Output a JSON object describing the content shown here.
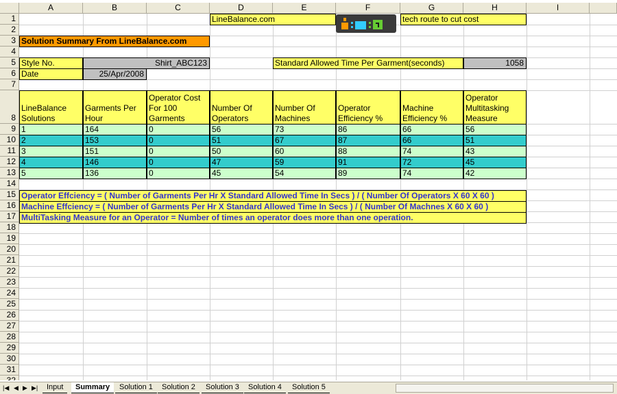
{
  "columns": [
    "A",
    "B",
    "C",
    "D",
    "E",
    "F",
    "G",
    "H",
    "I"
  ],
  "rows": [
    "1",
    "2",
    "3",
    "4",
    "5",
    "6",
    "7",
    "8",
    "9",
    "10",
    "11",
    "12",
    "13",
    "14",
    "15",
    "16",
    "17",
    "18",
    "19",
    "20",
    "21",
    "22",
    "23",
    "24",
    "25",
    "26",
    "27",
    "28",
    "29",
    "30",
    "31",
    "32"
  ],
  "header_cells": {
    "linebalance": "LineBalance.com",
    "tech_route": "tech route to cut cost",
    "summary_title": "Solution Summary From LineBalance.com",
    "style_label": "Style No.",
    "style_value": "Shirt_ABC123",
    "date_label": "Date",
    "date_value": "25/Apr/2008",
    "sat_label": "Standard Allowed Time Per Garment(seconds)",
    "sat_value": "1058"
  },
  "table_headers": [
    "LineBalance Solutions",
    "Garments Per Hour",
    "Operator Cost For 100 Garments",
    "Number Of Operators",
    "Number Of Machines",
    "Operator Efficiency %",
    "Machine Efficiency %",
    "Operator Multitasking Measure"
  ],
  "table_rows": [
    [
      "1",
      "164",
      "0",
      "56",
      "73",
      "86",
      "66",
      "56"
    ],
    [
      "2",
      "153",
      "0",
      "51",
      "67",
      "87",
      "66",
      "51"
    ],
    [
      "3",
      "151",
      "0",
      "50",
      "60",
      "88",
      "74",
      "43"
    ],
    [
      "4",
      "146",
      "0",
      "47",
      "59",
      "91",
      "72",
      "45"
    ],
    [
      "5",
      "136",
      "0",
      "45",
      "54",
      "89",
      "74",
      "42"
    ]
  ],
  "notes": [
    "Operator Effciency = ( Number of Garments Per Hr X Standard Allowed Time In Secs ) / (  Number Of Operators  X 60 X 60 )",
    "Machine Effciency = ( Number of Garments Per Hr X Standard Allowed Time In Secs ) / (  Number Of Machnes  X 60 X 60 )",
    "MultiTasking Measure for an Operator = Number of times an operator does more than one operation."
  ],
  "tabs": [
    "Input",
    "Summary",
    "Solution 1",
    "Solution 2",
    "Solution 3",
    "Solution 4",
    "Solution 5"
  ],
  "active_tab": "Summary",
  "colors": {
    "yellow": "#ffff66",
    "orange": "#ff9900",
    "green": "#ccffcc",
    "teal": "#33cccc",
    "note_text": "#3333cc"
  }
}
